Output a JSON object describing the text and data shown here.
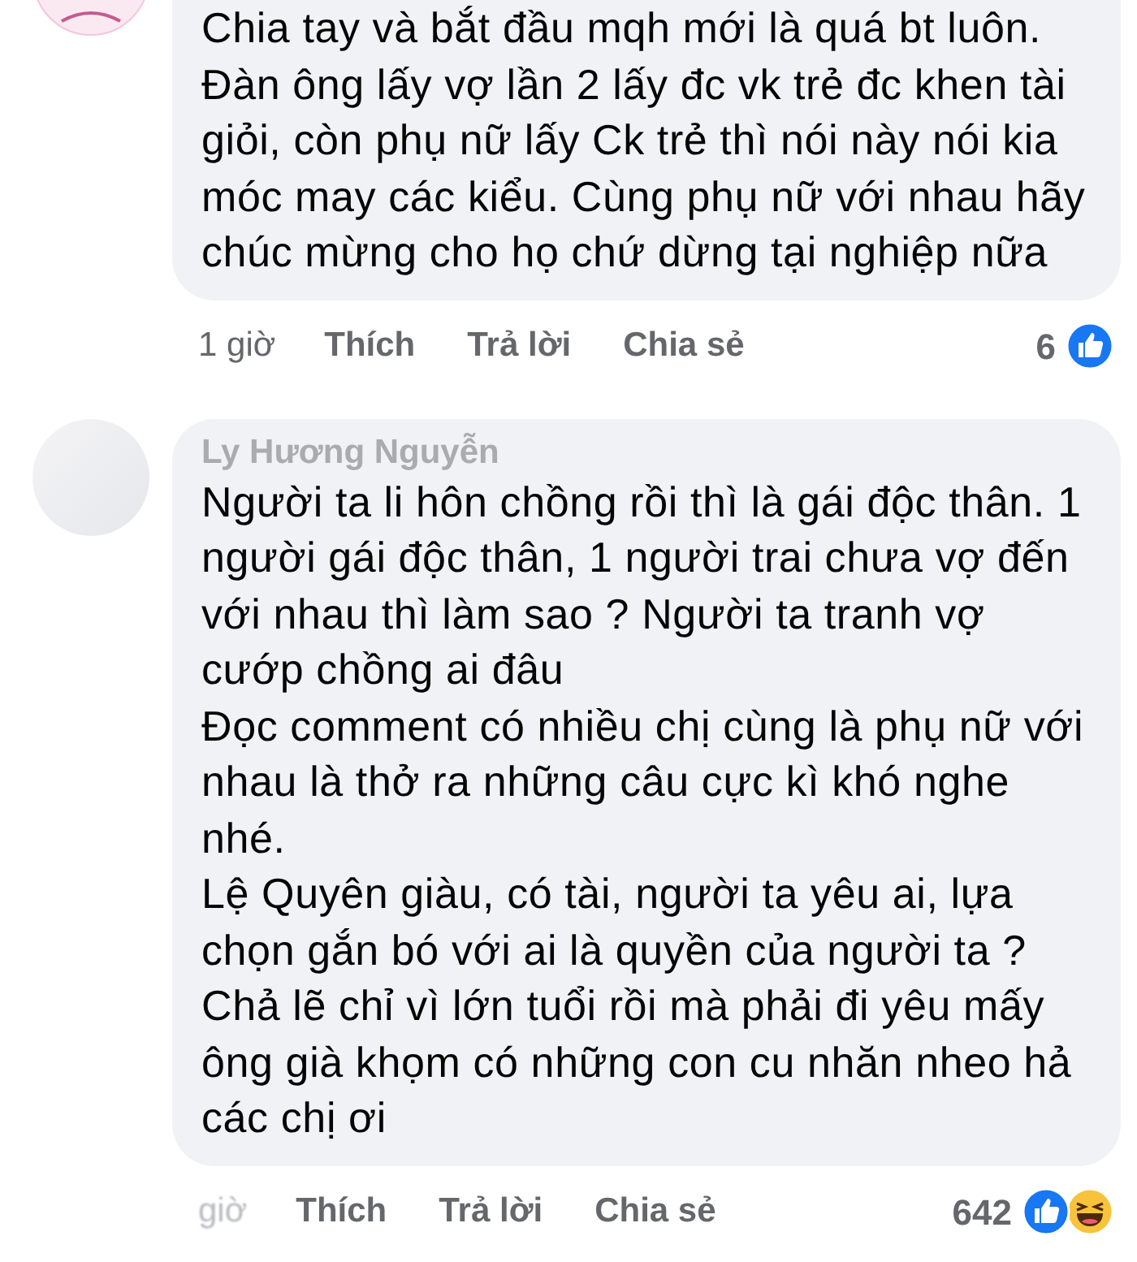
{
  "comments": [
    {
      "avatar": {
        "kind": "logo"
      },
      "paragraphs": [
        "Chia tay và bắt đầu mqh mới là quá bt luôn. Đàn ông lấy vợ lần 2 lấy đc vk trẻ đc khen tài giỏi, còn phụ nữ lấy Ck trẻ thì nói này nói kia móc may các kiểu. Cùng phụ nữ với nhau hãy chúc mừng cho họ chứ dừng tại nghiệp nữa"
      ],
      "time": "1 giờ",
      "time_blurred": false,
      "actions": [
        "Thích",
        "Trả lời",
        "Chia sẻ"
      ],
      "count": "6",
      "reactions": [
        {
          "kind": "like"
        }
      ]
    },
    {
      "avatar": {
        "kind": "blank"
      },
      "author": "Ly Hương Nguyễn",
      "paragraphs": [
        "Người ta li hôn chồng rồi thì là gái độc thân. 1 người gái độc thân, 1 người trai chưa vợ đến với nhau thì làm sao ? Người ta tranh vợ cướp chồng ai đâu",
        "Đọc comment có nhiều chị cùng là phụ nữ với nhau là thở ra những câu cực kì khó nghe nhé.",
        "Lệ Quyên giàu, có tài, người ta yêu ai, lựa chọn gắn bó với ai là quyền của người ta ?",
        "Chả lẽ chỉ vì lớn tuổi rồi mà phải đi yêu mấy ông già khọm có những con cu nhăn nheo hả các chị ơi"
      ],
      "time": "giờ",
      "time_blurred": true,
      "actions": [
        "Thích",
        "Trả lời",
        "Chia sẻ"
      ],
      "count": "642",
      "reactions": [
        {
          "kind": "like"
        },
        {
          "kind": "haha"
        }
      ]
    }
  ]
}
